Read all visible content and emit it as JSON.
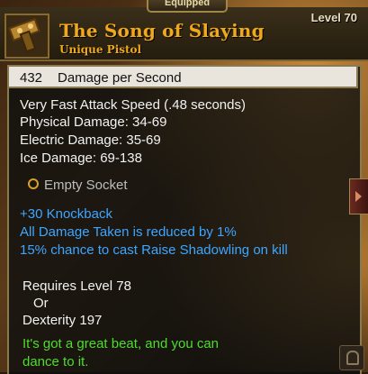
{
  "tooltip": {
    "equipped_label": "Equipped",
    "item_name": "The Song of Slaying",
    "item_type": "Unique Pistol",
    "item_level": "Level 70",
    "dps_value": "432",
    "dps_label": "Damage per Second",
    "attack_speed": "Very Fast Attack Speed (.48 seconds)",
    "physical_damage": "Physical Damage: 34-69",
    "electric_damage": "Electric Damage: 35-69",
    "ice_damage": "Ice Damage: 69-138",
    "socket_label": "Empty Socket",
    "bonus_knockback": "+30 Knockback",
    "bonus_damage_taken": "All Damage Taken is reduced by 1%",
    "bonus_shadowling": "15% chance to cast Raise Shadowling on kill",
    "requires_level": "Requires Level 78",
    "requires_or": "Or",
    "requires_dexterity": "Dexterity 197",
    "flavor_line1": "It's got a great beat, and you can",
    "flavor_line2": "dance to it."
  },
  "colors": {
    "item_name": "#f0a81c",
    "bonus_text": "#3fa6ff",
    "flavor_text": "#4fdc2c",
    "socket_ring": "#d9a02c"
  },
  "icons": {
    "item_icon": "pistol-icon",
    "socket_icon": "socket-ring-icon",
    "side_tab_icon": "chevron-right-icon",
    "corner_icon": "lock-icon"
  }
}
